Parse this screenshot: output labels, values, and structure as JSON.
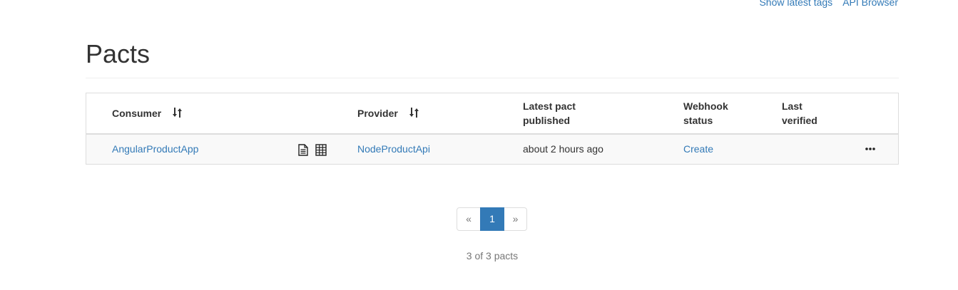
{
  "nav": {
    "links": [
      {
        "label": "Show latest tags"
      },
      {
        "label": "API Browser"
      }
    ]
  },
  "page": {
    "title": "Pacts"
  },
  "table": {
    "headers": {
      "consumer": "Consumer",
      "provider": "Provider",
      "latest_pact_published": "Latest pact published",
      "webhook_status": "Webhook status",
      "last_verified": "Last verified"
    },
    "sort_icon": "sort-arrows-icon",
    "rows": [
      {
        "consumer": "AngularProductApp",
        "consumer_icons": [
          "document-icon",
          "matrix-grid-icon"
        ],
        "provider": "NodeProductApi",
        "latest_pact_published": "about 2 hours ago",
        "webhook_status": "Create",
        "last_verified": "",
        "actions_icon": "ellipsis-icon"
      }
    ]
  },
  "pagination": {
    "prev": "«",
    "current": "1",
    "next": "»"
  },
  "summary": {
    "count_text": "3 of 3 pacts"
  },
  "colors": {
    "link": "#337ab7",
    "active_page": "#337ab7",
    "border": "#dddddd",
    "row_bg": "#f9f9f9",
    "muted_text": "#777777"
  }
}
